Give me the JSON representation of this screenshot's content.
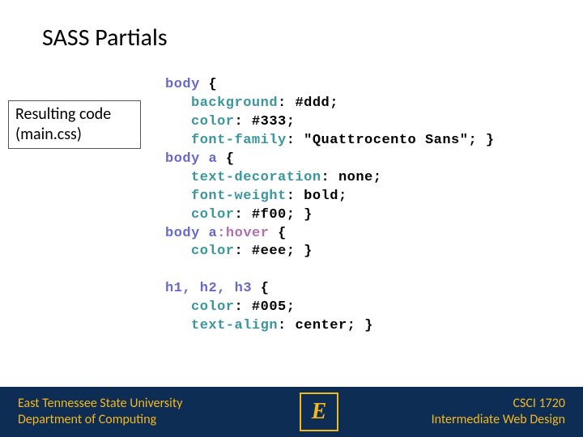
{
  "title": "SASS Partials",
  "annotation": {
    "line1": "Resulting code",
    "line2": "(main.css)"
  },
  "code": {
    "l1_sel": "body",
    "l1_brace": "{",
    "l2_prop": "background",
    "l2_val": "#ddd",
    "l3_prop": "color",
    "l3_val": "#333",
    "l4_prop": "font-family",
    "l4_val": "\"Quattrocento Sans\"",
    "l4_brace": "}",
    "l5_sel": "body a",
    "l5_brace": "{",
    "l6_prop": "text-decoration",
    "l6_val": "none",
    "l7_prop": "font-weight",
    "l7_val": "bold",
    "l8_prop": "color",
    "l8_val": "#f00",
    "l8_brace": "}",
    "l9_sel": "body a",
    "l9_pseudo": ":hover",
    "l9_brace": "{",
    "l10_prop": "color",
    "l10_val": "#eee",
    "l10_brace": "}",
    "l12_sel": "h1, h2, h3",
    "l12_brace": "{",
    "l13_prop": "color",
    "l13_val": "#005",
    "l14_prop": "text-align",
    "l14_val": "center",
    "l14_brace": "}"
  },
  "footer": {
    "university": "East Tennessee State University",
    "department": "Department of Computing",
    "course_code": "CSCI 1720",
    "course_name": "Intermediate Web Design",
    "logo_letter": "E"
  }
}
